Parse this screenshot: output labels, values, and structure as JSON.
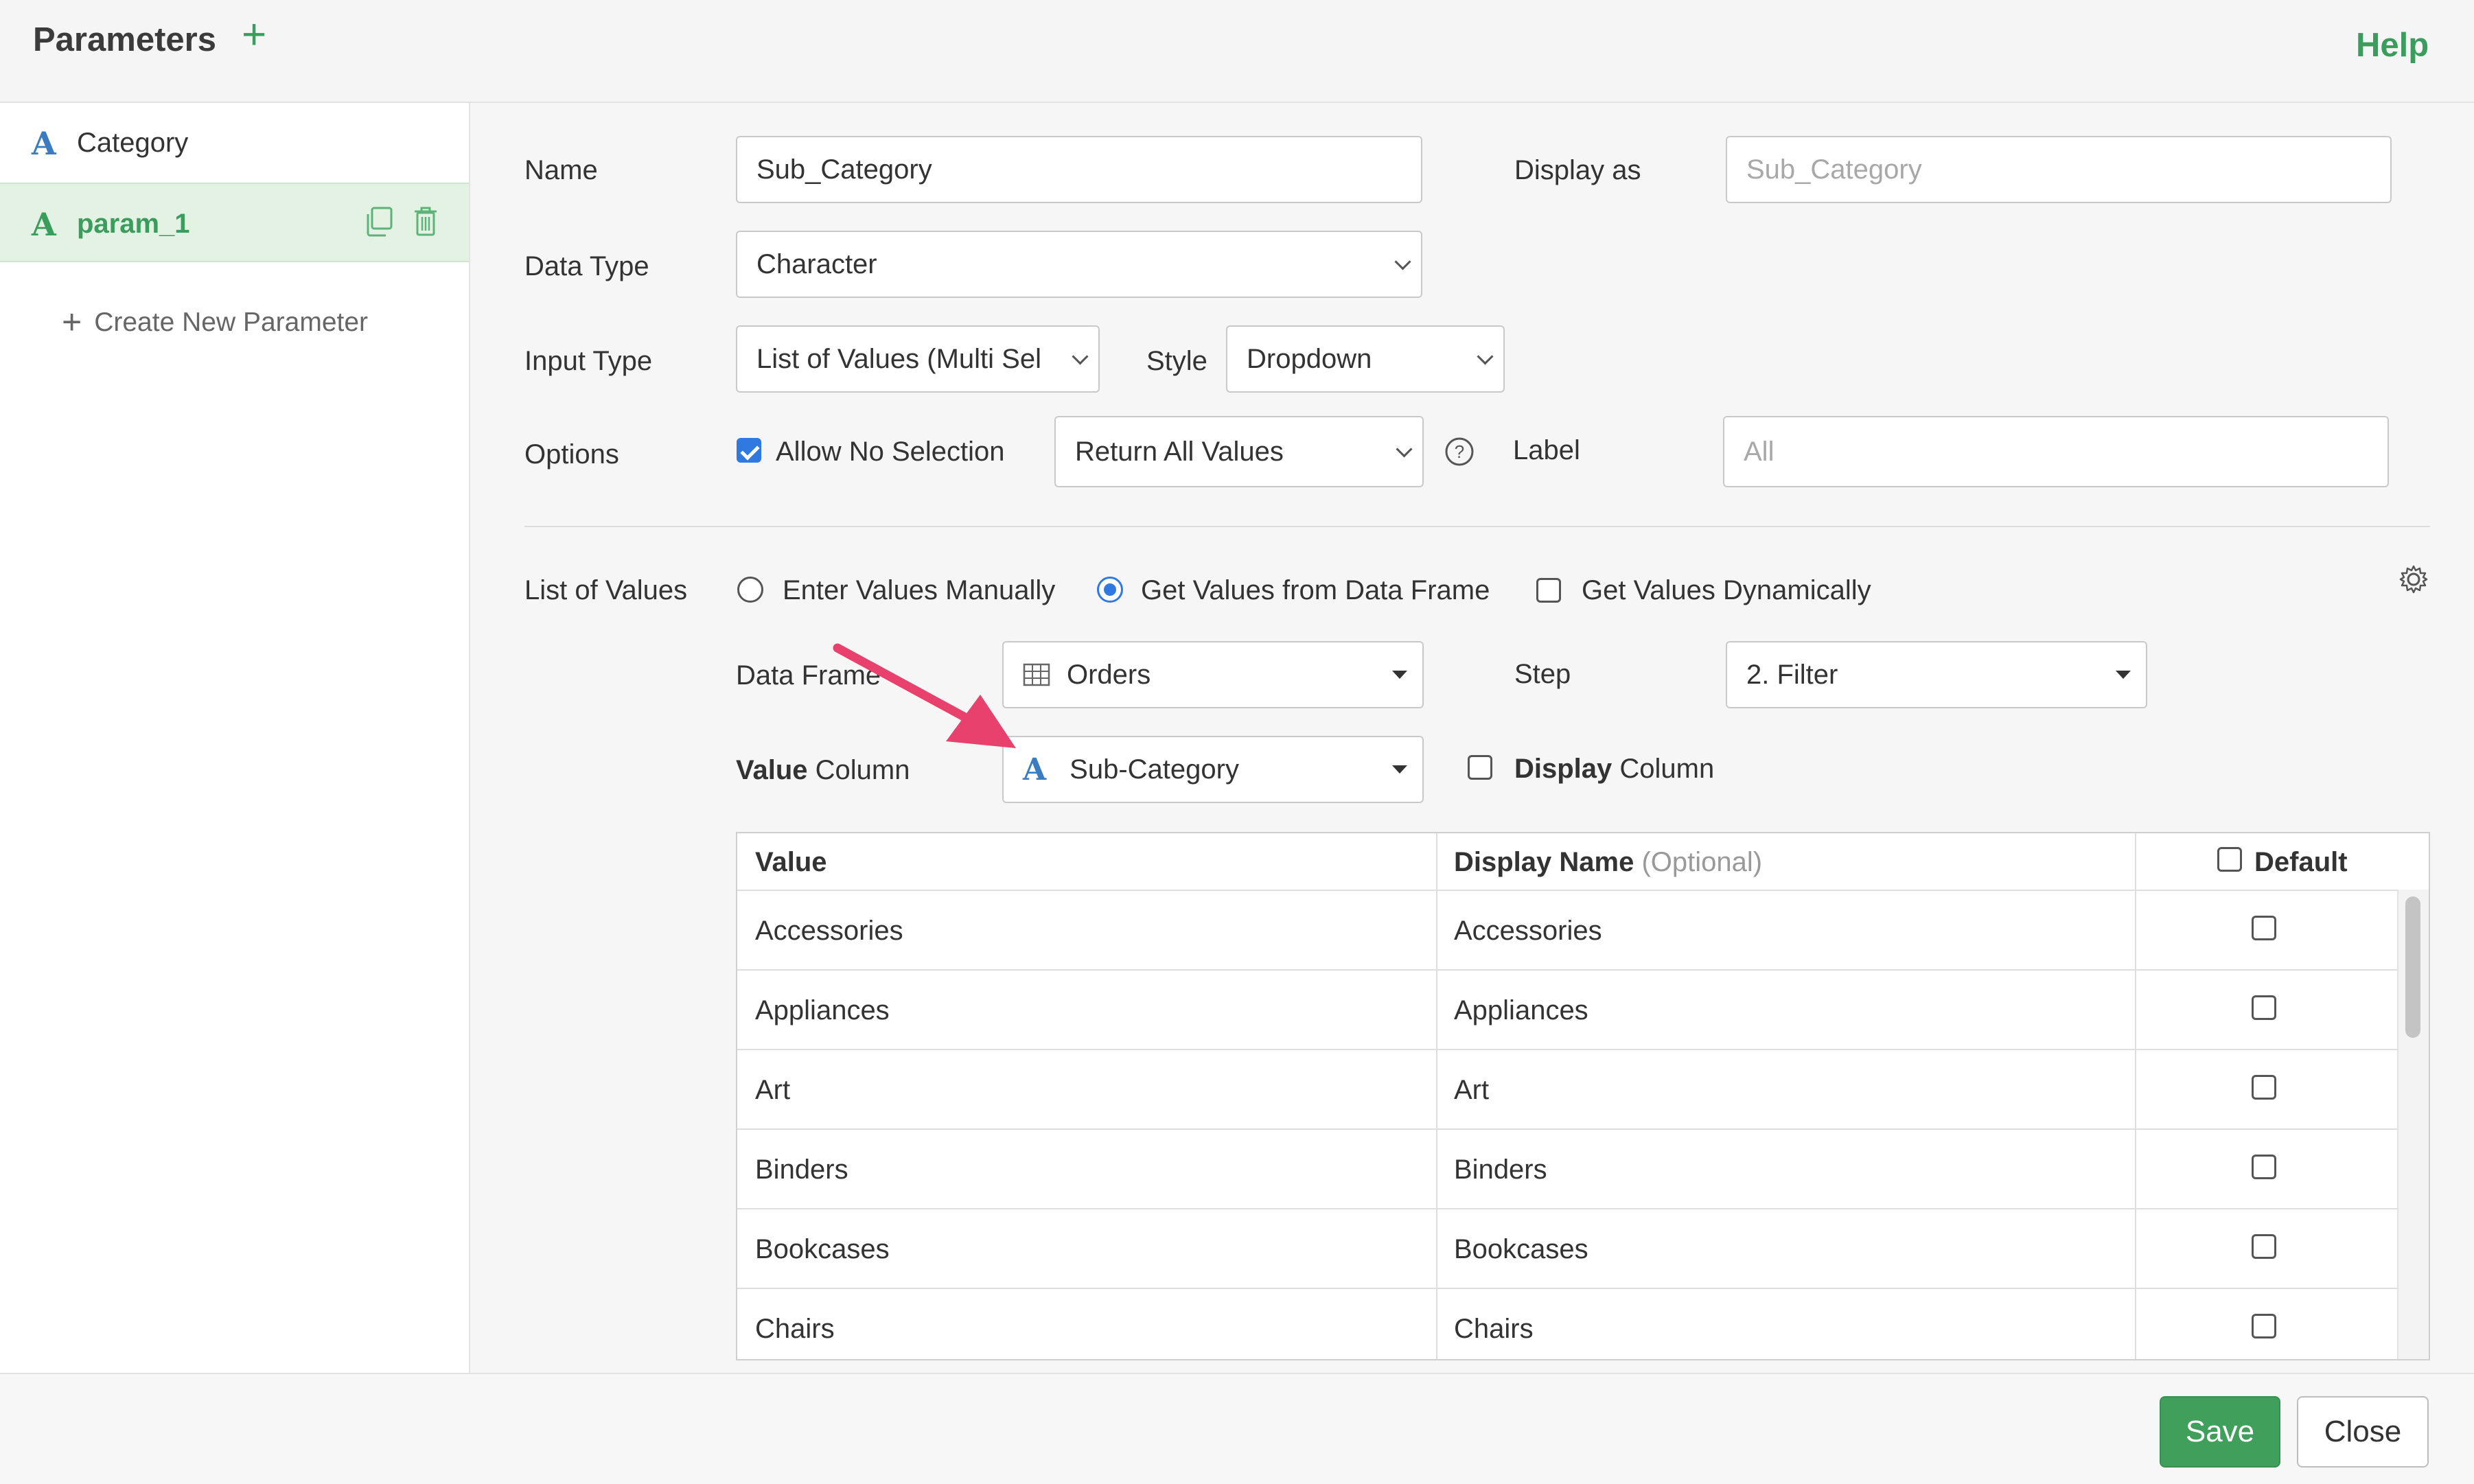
{
  "header": {
    "title": "Parameters",
    "add_icon": "plus-icon",
    "help_label": "Help"
  },
  "sidebar": {
    "items": [
      {
        "type_icon": "A",
        "label": "Category",
        "active": false
      },
      {
        "type_icon": "A",
        "label": "param_1",
        "active": true,
        "actions": [
          "copy-icon",
          "trash-icon"
        ]
      }
    ],
    "create_new_label": "Create New Parameter"
  },
  "form": {
    "name_label": "Name",
    "name_value": "Sub_Category",
    "display_as_label": "Display as",
    "display_as_placeholder": "Sub_Category",
    "data_type_label": "Data Type",
    "data_type_value": "Character",
    "input_type_label": "Input Type",
    "input_type_value": "List of Values (Multi Sel",
    "style_label": "Style",
    "style_value": "Dropdown",
    "options_label": "Options",
    "allow_no_selection_label": "Allow No Selection",
    "allow_no_selection_checked": true,
    "no_selection_behavior_value": "Return All Values",
    "label_label": "Label",
    "label_placeholder": "All"
  },
  "list_of_values": {
    "section_label": "List of Values",
    "source_options": [
      {
        "label": "Enter Values Manually",
        "selected": false
      },
      {
        "label": "Get Values from Data Frame",
        "selected": true
      }
    ],
    "dynamic_label": "Get Values Dynamically",
    "dynamic_checked": false,
    "data_frame_label": "Data Frame",
    "data_frame_value": "Orders",
    "step_label": "Step",
    "step_value": "2. Filter",
    "value_column_label_bold": "Value",
    "value_column_label_rest": " Column",
    "value_column_value": "Sub-Category",
    "value_column_type_icon": "A",
    "display_column_label_bold": "Display",
    "display_column_label_rest": " Column",
    "display_column_checked": false
  },
  "table": {
    "headers": {
      "value": "Value",
      "display_name": "Display Name",
      "display_name_hint": "(Optional)",
      "default": "Default"
    },
    "rows": [
      {
        "value": "Accessories",
        "display_name": "Accessories",
        "default": false
      },
      {
        "value": "Appliances",
        "display_name": "Appliances",
        "default": false
      },
      {
        "value": "Art",
        "display_name": "Art",
        "default": false
      },
      {
        "value": "Binders",
        "display_name": "Binders",
        "default": false
      },
      {
        "value": "Bookcases",
        "display_name": "Bookcases",
        "default": false
      },
      {
        "value": "Chairs",
        "display_name": "Chairs",
        "default": false
      }
    ]
  },
  "footer": {
    "save_label": "Save",
    "close_label": "Close"
  },
  "colors": {
    "accent_green": "#3a9d5d",
    "type_blue": "#3b7bbf",
    "annotation_arrow": "#e8416e",
    "checkbox_blue": "#2f79e0"
  }
}
